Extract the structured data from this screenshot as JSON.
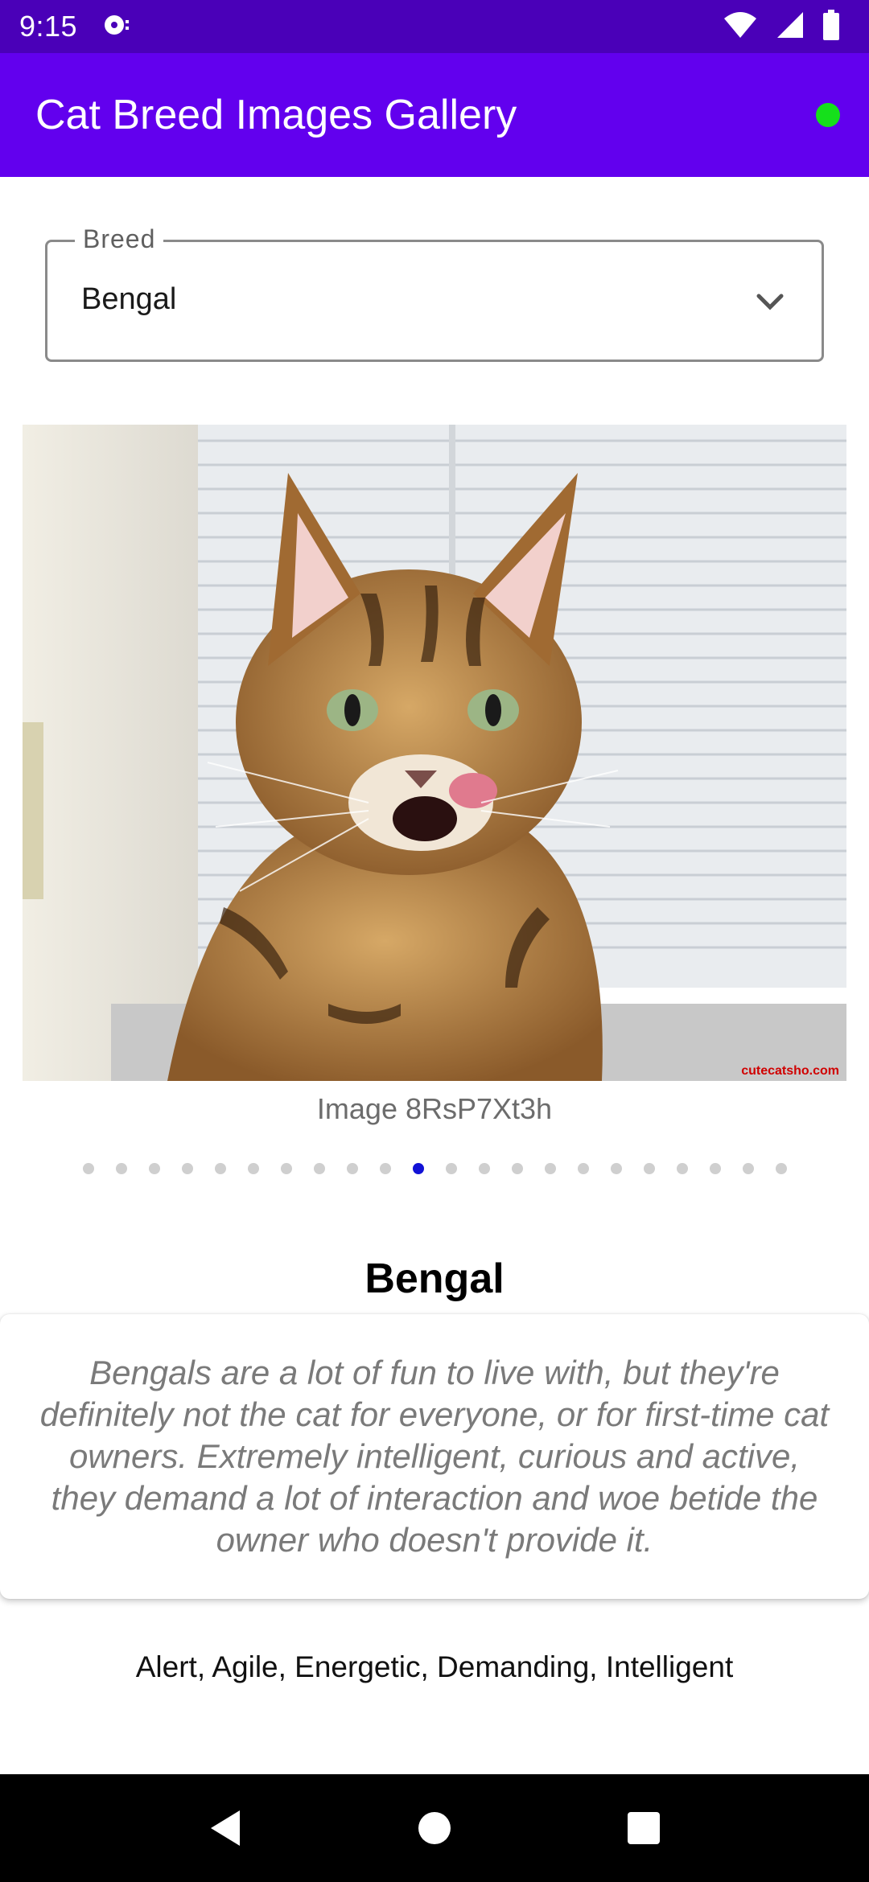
{
  "status_bar": {
    "time": "9:15",
    "icons": [
      "media-icon",
      "wifi-icon",
      "cell-signal-icon",
      "battery-icon"
    ]
  },
  "app_bar": {
    "title": "Cat Breed Images Gallery",
    "status_color": "#15e01b"
  },
  "breed_select": {
    "label": "Breed",
    "value": "Bengal"
  },
  "gallery": {
    "image_alt": "Bengal cat licking its lips",
    "caption": "Image 8RsP7Xt3h",
    "dot_count": 22,
    "active_index": 10,
    "watermark": "cutecatsho.com"
  },
  "details": {
    "name": "Bengal",
    "description": "Bengals are a lot of fun to live with, but they're definitely not the cat for everyone, or for first-time cat owners. Extremely intelligent, curious and active, they demand a lot of interaction and woe betide the owner who doesn't provide it.",
    "temperament": "Alert, Agile, Energetic, Demanding, Intelligent"
  },
  "colors": {
    "status_bar": "#4a00b8",
    "app_bar": "#6200ee",
    "active_dot": "#1212d6"
  },
  "nav_bar": {
    "buttons": [
      "back-icon",
      "home-icon",
      "recents-icon"
    ]
  }
}
